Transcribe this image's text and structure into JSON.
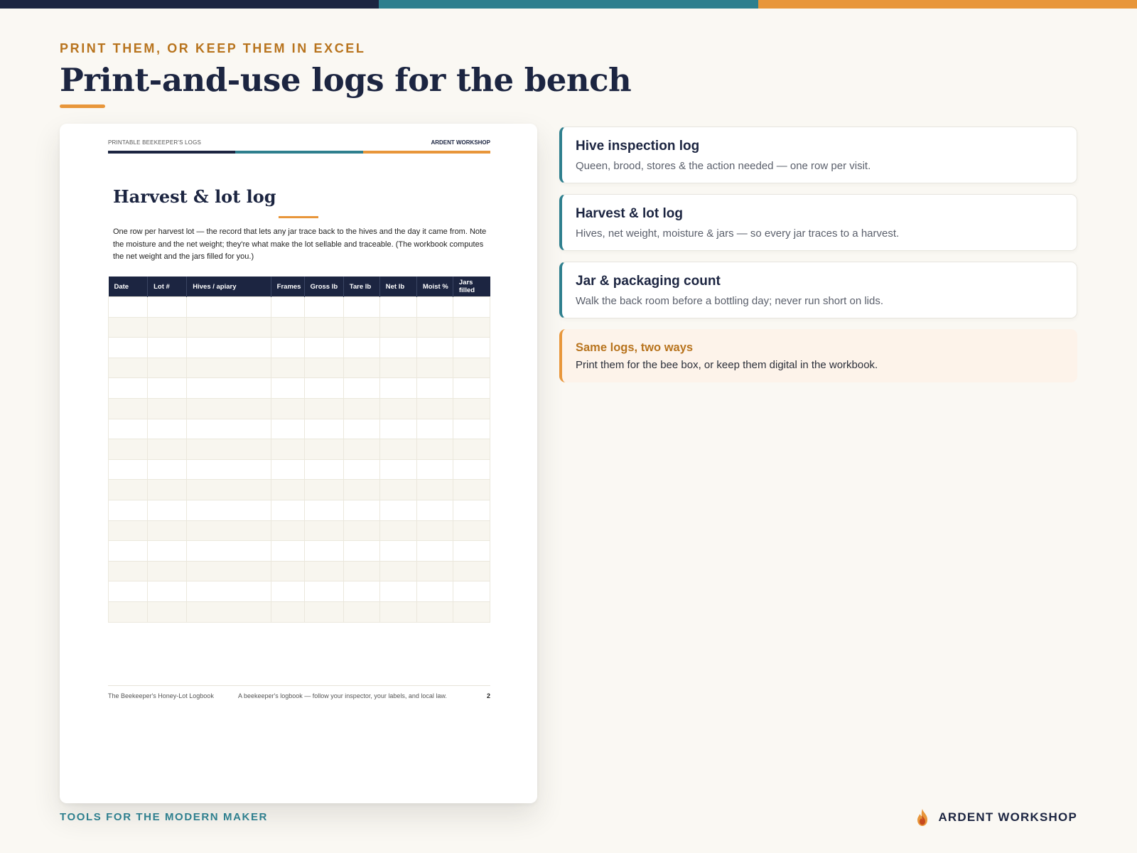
{
  "colors": {
    "navy": "#1c2541",
    "teal": "#2e7f8e",
    "orange": "#e8963a",
    "ochre": "#b8741e"
  },
  "header": {
    "eyebrow": "PRINT THEM, OR KEEP THEM IN EXCEL",
    "title": "Print-and-use logs for the bench"
  },
  "preview": {
    "header_left": "PRINTABLE BEEKEEPER'S LOGS",
    "header_right": "ARDENT WORKSHOP",
    "title": "Harvest & lot log",
    "description": "One row per harvest lot — the record that lets any jar trace back to the hives and the day it came from. Note the moisture and the net weight; they're what make the lot sellable and traceable. (The workbook computes the net weight and the jars filled for you.)",
    "columns": [
      "Date",
      "Lot #",
      "Hives / apiary",
      "Frames",
      "Gross lb",
      "Tare lb",
      "Net lb",
      "Moist %",
      "Jars filled"
    ],
    "blank_rows": 16,
    "footer_left": "The Beekeeper's Honey-Lot Logbook",
    "footer_mid": "A beekeeper's logbook — follow your inspector, your labels, and local law.",
    "page_number": "2"
  },
  "cards": [
    {
      "title": "Hive inspection log",
      "description": "Queen, brood, stores & the action needed — one row per visit."
    },
    {
      "title": "Harvest & lot log",
      "description": "Hives, net weight, moisture & jars — so every jar traces to a harvest."
    },
    {
      "title": "Jar & packaging count",
      "description": "Walk the back room before a bottling day; never run short on lids."
    }
  ],
  "note": {
    "title": "Same logs, two ways",
    "description": "Print them for the bee box, or keep them digital in the workbook."
  },
  "footer": {
    "tagline": "TOOLS FOR THE MODERN MAKER",
    "brand": "ARDENT WORKSHOP",
    "brand_icon": "flame-icon"
  }
}
